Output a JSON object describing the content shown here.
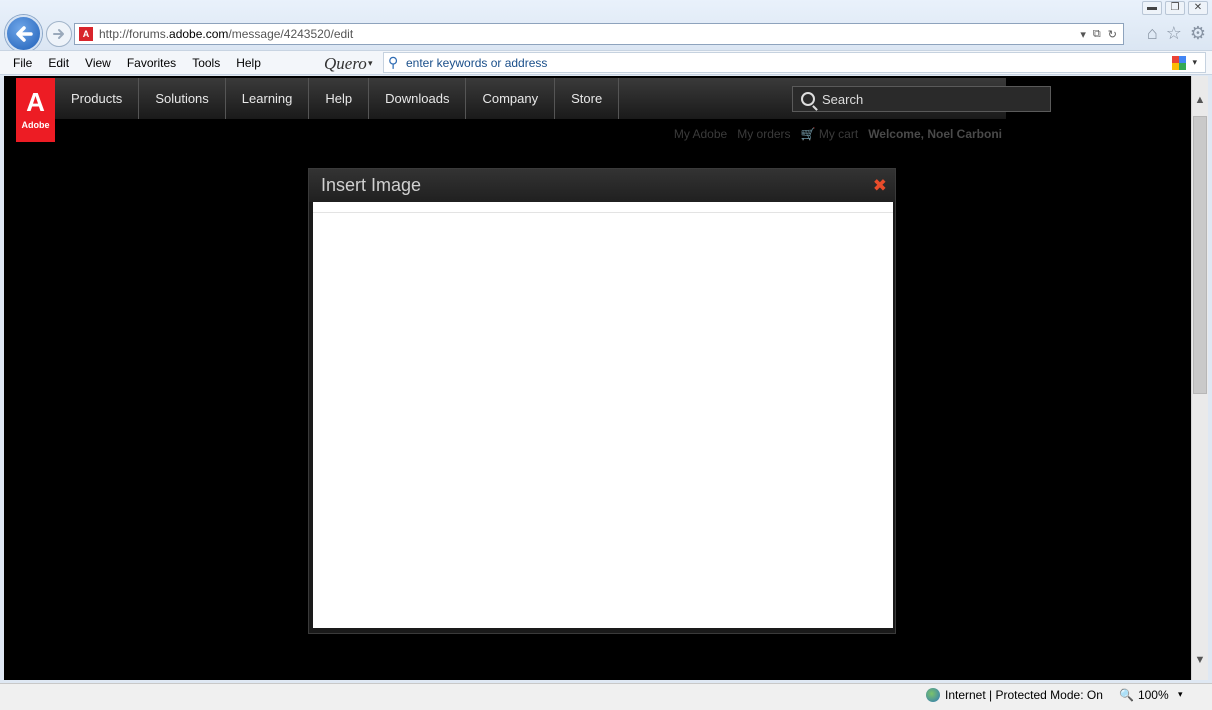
{
  "browser": {
    "window_controls": {
      "minimize": "▬",
      "restore": "❐",
      "close": "✕"
    },
    "back_icon": "back-arrow-icon",
    "forward_icon": "forward-arrow-icon",
    "url_prefix": "http://forums.",
    "url_host": "adobe.com",
    "url_path": "/message/4243520/edit",
    "favicon_text": "A",
    "address_tools": {
      "dropdown": "▾",
      "compat": "⧉",
      "refresh": "↻"
    },
    "tools": {
      "home": "⌂",
      "favorites": "☆",
      "settings": "⚙"
    }
  },
  "menu": {
    "items": [
      "File",
      "Edit",
      "View",
      "Favorites",
      "Tools",
      "Help"
    ],
    "quero_logo": "Quero",
    "quero_dropdown": "▾",
    "search_placeholder": "enter keywords or address",
    "google_dropdown": "▾"
  },
  "site": {
    "logo_mark": "A",
    "logo_word": "Adobe",
    "nav_tabs": [
      "Products",
      "Solutions",
      "Learning",
      "Help",
      "Downloads",
      "Company",
      "Store"
    ],
    "search_label": "Search",
    "user_links": {
      "my_adobe": "My Adobe",
      "my_orders": "My orders",
      "my_cart": "My cart",
      "cart_icon": "🛒",
      "welcome": "Welcome, Noel Carboni"
    }
  },
  "modal": {
    "title": "Insert Image",
    "close_symbol": "✖"
  },
  "scrollbar": {
    "up": "▲",
    "down": "▼"
  },
  "status": {
    "zone": "Internet | Protected Mode: On",
    "zoom_icon": "🔍",
    "zoom": "100%",
    "zoom_dropdown": "▾"
  }
}
